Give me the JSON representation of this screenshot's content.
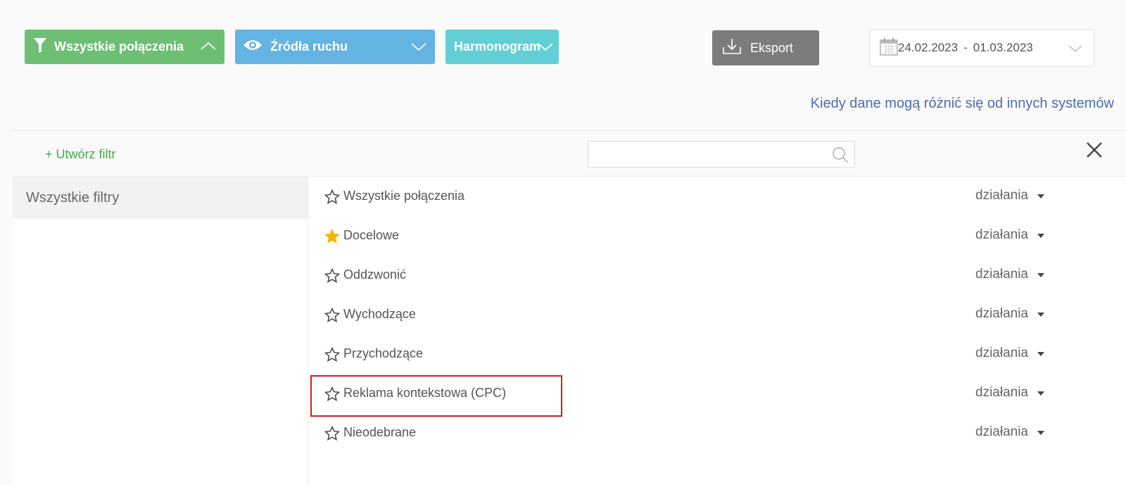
{
  "toolbar": {
    "calls_label": "Wszystkie połączenia",
    "sources_label": "Źródła ruchu",
    "schedule_label": "Harmonogram",
    "export_label": "Eksport"
  },
  "date_range": {
    "from": "24.02.2023",
    "separator": "-",
    "to": "01.03.2023"
  },
  "diff_link": "Kiedy dane mogą różnić się od innych systemów",
  "filter_panel": {
    "create_filter": "+ Utwórz filtr",
    "search_value": "",
    "sidebar": [
      {
        "label": "Wszystkie filtry"
      }
    ],
    "filters": [
      {
        "name": "Wszystkie połączenia",
        "starred": false,
        "actions": "działania"
      },
      {
        "name": "Docelowe",
        "starred": true,
        "actions": "działania"
      },
      {
        "name": "Oddzwonić",
        "starred": false,
        "actions": "działania"
      },
      {
        "name": "Wychodzące",
        "starred": false,
        "actions": "działania"
      },
      {
        "name": "Przychodzące",
        "starred": false,
        "actions": "działania"
      },
      {
        "name": "Reklama kontekstowa (CPC)",
        "starred": false,
        "actions": "działania"
      },
      {
        "name": "Nieodebrane",
        "starred": false,
        "actions": "działania"
      }
    ]
  },
  "colors": {
    "calls_button": "#6dbf73",
    "sources_button": "#63b3e3",
    "schedule_button": "#62cfd6",
    "export_button": "#7c7c7c",
    "link": "#4a6ea8",
    "create_filter": "#3fae47",
    "star_active": "#f5b400",
    "highlight": "#cc1f1f"
  },
  "icons": {
    "calls": "funnel-icon",
    "sources": "eye-icon",
    "export": "download-icon",
    "date": "calendar-icon",
    "search": "search-icon",
    "close": "close-icon"
  }
}
